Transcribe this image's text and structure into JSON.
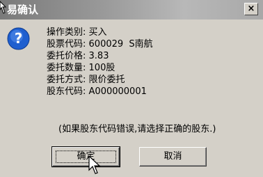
{
  "dialog": {
    "title": "易确认",
    "close_label": "×"
  },
  "details": {
    "rows": [
      {
        "label": "操作类别:",
        "value": "买入"
      },
      {
        "label": "股票代码:",
        "value": "600029  S南航"
      },
      {
        "label": "委托价格:",
        "value": "3.83"
      },
      {
        "label": "委托数量:",
        "value": "100股"
      },
      {
        "label": "委托方式:",
        "value": "限价委托"
      },
      {
        "label": "股东代码:",
        "value": "A000000001"
      }
    ],
    "note": "(如果股东代码错误,请选择正确的股东.)"
  },
  "buttons": {
    "confirm_label": "确定",
    "cancel_label": "取消"
  },
  "colors": {
    "face": "#d4d0c8",
    "icon_blue": "#1f5fcf"
  },
  "icons": {
    "dialog_icon": "question-icon",
    "cursor": "mouse-pointer-icon"
  }
}
